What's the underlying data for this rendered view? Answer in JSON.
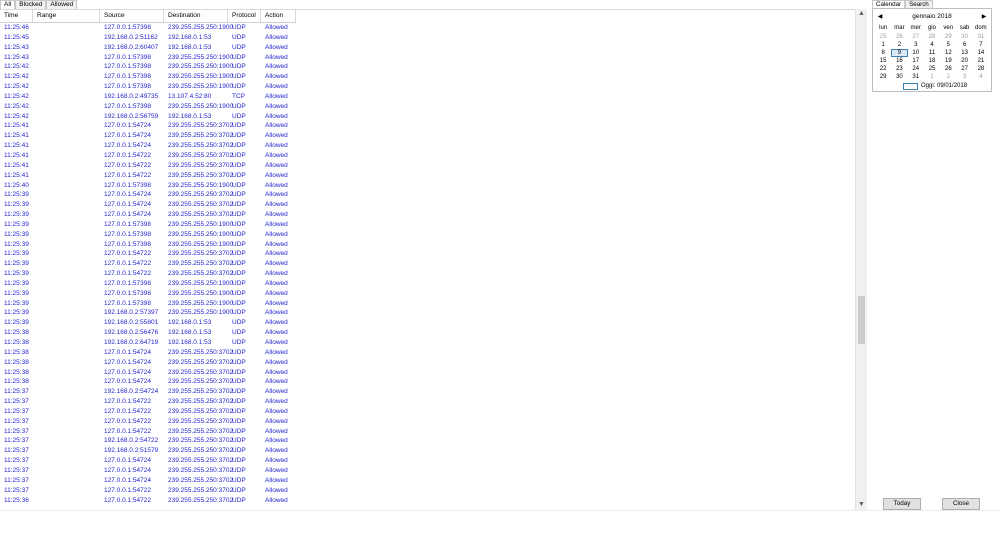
{
  "tabs": [
    "All",
    "Blocked",
    "Allowed"
  ],
  "columns": [
    "Time",
    "Range",
    "Source",
    "Destination",
    "Protocol",
    "Action"
  ],
  "rows": [
    [
      "11:25:46",
      "",
      "127.0.0.1:57398",
      "239.255.255.250:1900",
      "UDP",
      "Allowed"
    ],
    [
      "11:25:45",
      "",
      "192.168.0.2:51162",
      "192.168.0.1:53",
      "UDP",
      "Allowed"
    ],
    [
      "11:25:43",
      "",
      "192.168.0.2:60407",
      "192.168.0.1:53",
      "UDP",
      "Allowed"
    ],
    [
      "11:25:43",
      "",
      "127.0.0.1:57398",
      "239.255.255.250:1900",
      "UDP",
      "Allowed"
    ],
    [
      "11:25:42",
      "",
      "127.0.0.1:57398",
      "239.255.255.250:1900",
      "UDP",
      "Allowed"
    ],
    [
      "11:25:42",
      "",
      "127.0.0.1:57398",
      "239.255.255.250:1900",
      "UDP",
      "Allowed"
    ],
    [
      "11:25:42",
      "",
      "127.0.0.1:57398",
      "239.255.255.250:1900",
      "UDP",
      "Allowed"
    ],
    [
      "11:25:42",
      "",
      "192.168.0.2:49735",
      "13.107.4.52:80",
      "TCP",
      "Allowed"
    ],
    [
      "11:25:42",
      "",
      "127.0.0.1:57398",
      "239.255.255.250:1900",
      "UDP",
      "Allowed"
    ],
    [
      "11:25:42",
      "",
      "192.168.0.2:56759",
      "192.168.0.1:53",
      "UDP",
      "Allowed"
    ],
    [
      "11:25:41",
      "",
      "127.0.0.1:54724",
      "239.255.255.250:3702",
      "UDP",
      "Allowed"
    ],
    [
      "11:25:41",
      "",
      "127.0.0.1:54724",
      "239.255.255.250:3702",
      "UDP",
      "Allowed"
    ],
    [
      "11:25:41",
      "",
      "127.0.0.1:54724",
      "239.255.255.250:3702",
      "UDP",
      "Allowed"
    ],
    [
      "11:25:41",
      "",
      "127.0.0.1:54722",
      "239.255.255.250:3702",
      "UDP",
      "Allowed"
    ],
    [
      "11:25:41",
      "",
      "127.0.0.1:54722",
      "239.255.255.250:3702",
      "UDP",
      "Allowed"
    ],
    [
      "11:25:41",
      "",
      "127.0.0.1:54722",
      "239.255.255.250:3702",
      "UDP",
      "Allowed"
    ],
    [
      "11:25:40",
      "",
      "127.0.0.1:57398",
      "239.255.255.250:1900",
      "UDP",
      "Allowed"
    ],
    [
      "11:25:39",
      "",
      "127.0.0.1:54724",
      "239.255.255.250:3702",
      "UDP",
      "Allowed"
    ],
    [
      "11:25:39",
      "",
      "127.0.0.1:54724",
      "239.255.255.250:3702",
      "UDP",
      "Allowed"
    ],
    [
      "11:25:39",
      "",
      "127.0.0.1:54724",
      "239.255.255.250:3702",
      "UDP",
      "Allowed"
    ],
    [
      "11:25:39",
      "",
      "127.0.0.1:57398",
      "239.255.255.250:1900",
      "UDP",
      "Allowed"
    ],
    [
      "11:25:39",
      "",
      "127.0.0.1:57398",
      "239.255.255.250:1900",
      "UDP",
      "Allowed"
    ],
    [
      "11:25:39",
      "",
      "127.0.0.1:57398",
      "239.255.255.250:1900",
      "UDP",
      "Allowed"
    ],
    [
      "11:25:39",
      "",
      "127.0.0.1:54722",
      "239.255.255.250:3702",
      "UDP",
      "Allowed"
    ],
    [
      "11:25:39",
      "",
      "127.0.0.1:54722",
      "239.255.255.250:3702",
      "UDP",
      "Allowed"
    ],
    [
      "11:25:39",
      "",
      "127.0.0.1:54722",
      "239.255.255.250:3702",
      "UDP",
      "Allowed"
    ],
    [
      "11:25:39",
      "",
      "127.0.0.1:57398",
      "239.255.255.250:1900",
      "UDP",
      "Allowed"
    ],
    [
      "11:25:39",
      "",
      "127.0.0.1:57398",
      "239.255.255.250:1900",
      "UDP",
      "Allowed"
    ],
    [
      "11:25:39",
      "",
      "127.0.0.1:57398",
      "239.255.255.250:1900",
      "UDP",
      "Allowed"
    ],
    [
      "11:25:39",
      "",
      "192.168.0.2:57397",
      "239.255.255.250:1900",
      "UDP",
      "Allowed"
    ],
    [
      "11:25:39",
      "",
      "192.168.0.2:55801",
      "192.168.0.1:53",
      "UDP",
      "Allowed"
    ],
    [
      "11:25:38",
      "",
      "192.168.0.2:56476",
      "192.168.0.1:53",
      "UDP",
      "Allowed"
    ],
    [
      "11:25:38",
      "",
      "192.168.0.2:64719",
      "192.168.0.1:53",
      "UDP",
      "Allowed"
    ],
    [
      "11:25:38",
      "",
      "127.0.0.1:54724",
      "239.255.255.250:3702",
      "UDP",
      "Allowed"
    ],
    [
      "11:25:38",
      "",
      "127.0.0.1:54724",
      "239.255.255.250:3702",
      "UDP",
      "Allowed"
    ],
    [
      "11:25:38",
      "",
      "127.0.0.1:54724",
      "239.255.255.250:3702",
      "UDP",
      "Allowed"
    ],
    [
      "11:25:38",
      "",
      "127.0.0.1:54724",
      "239.255.255.250:3702",
      "UDP",
      "Allowed"
    ],
    [
      "11:25:37",
      "",
      "192.168.0.2:54724",
      "239.255.255.250:3702",
      "UDP",
      "Allowed"
    ],
    [
      "11:25:37",
      "",
      "127.0.0.1:54722",
      "239.255.255.250:3702",
      "UDP",
      "Allowed"
    ],
    [
      "11:25:37",
      "",
      "127.0.0.1:54722",
      "239.255.255.250:3702",
      "UDP",
      "Allowed"
    ],
    [
      "11:25:37",
      "",
      "127.0.0.1:54722",
      "239.255.255.250:3702",
      "UDP",
      "Allowed"
    ],
    [
      "11:25:37",
      "",
      "127.0.0.1:54722",
      "239.255.255.250:3702",
      "UDP",
      "Allowed"
    ],
    [
      "11:25:37",
      "",
      "192.168.0.2:54722",
      "239.255.255.250:3702",
      "UDP",
      "Allowed"
    ],
    [
      "11:25:37",
      "",
      "192.168.0.2:51579",
      "239.255.255.250:3702",
      "UDP",
      "Allowed"
    ],
    [
      "11:25:37",
      "",
      "127.0.0.1:54724",
      "239.255.255.250:3702",
      "UDP",
      "Allowed"
    ],
    [
      "11:25:37",
      "",
      "127.0.0.1:54724",
      "239.255.255.250:3702",
      "UDP",
      "Allowed"
    ],
    [
      "11:25:37",
      "",
      "127.0.0.1:54724",
      "239.255.255.250:3702",
      "UDP",
      "Allowed"
    ],
    [
      "11:25:37",
      "",
      "127.0.0.1:54722",
      "239.255.255.250:3702",
      "UDP",
      "Allowed"
    ],
    [
      "11:25:36",
      "",
      "127.0.0.1:54722",
      "239.255.255.250:3702",
      "UDP",
      "Allowed"
    ]
  ],
  "row_text_color": "#1f1fd0",
  "scrollbar": {
    "position_fraction": 0.64,
    "thumb_fraction": 0.1
  },
  "right_tabs": [
    "Calendar",
    "Search"
  ],
  "calendar": {
    "prev": "◀",
    "next": "▶",
    "title": "gennaio 2018",
    "weekdays": [
      "lun",
      "mar",
      "mer",
      "gio",
      "ven",
      "sab",
      "dom"
    ],
    "weeks": [
      [
        [
          "25",
          true
        ],
        [
          "26",
          true
        ],
        [
          "27",
          true
        ],
        [
          "28",
          true
        ],
        [
          "29",
          true
        ],
        [
          "30",
          true
        ],
        [
          "31",
          true
        ]
      ],
      [
        [
          "1",
          false
        ],
        [
          "2",
          false
        ],
        [
          "3",
          false
        ],
        [
          "4",
          false
        ],
        [
          "5",
          false
        ],
        [
          "6",
          false
        ],
        [
          "7",
          false
        ]
      ],
      [
        [
          "8",
          false
        ],
        [
          "9",
          false
        ],
        [
          "10",
          false
        ],
        [
          "11",
          false
        ],
        [
          "12",
          false
        ],
        [
          "13",
          false
        ],
        [
          "14",
          false
        ]
      ],
      [
        [
          "15",
          false
        ],
        [
          "16",
          false
        ],
        [
          "17",
          false
        ],
        [
          "18",
          false
        ],
        [
          "19",
          false
        ],
        [
          "20",
          false
        ],
        [
          "21",
          false
        ]
      ],
      [
        [
          "22",
          false
        ],
        [
          "23",
          false
        ],
        [
          "24",
          false
        ],
        [
          "25",
          false
        ],
        [
          "26",
          false
        ],
        [
          "27",
          false
        ],
        [
          "28",
          false
        ]
      ],
      [
        [
          "29",
          false
        ],
        [
          "30",
          false
        ],
        [
          "31",
          false
        ],
        [
          "1",
          true
        ],
        [
          "2",
          true
        ],
        [
          "3",
          true
        ],
        [
          "4",
          true
        ]
      ]
    ],
    "selected_day": "9",
    "today_label": "Oggi: 09/01/2018"
  },
  "buttons": {
    "today": "Today",
    "close": "Close"
  },
  "icons": {
    "scroll_up": "chevron-up-icon",
    "scroll_down": "chevron-down-icon"
  }
}
